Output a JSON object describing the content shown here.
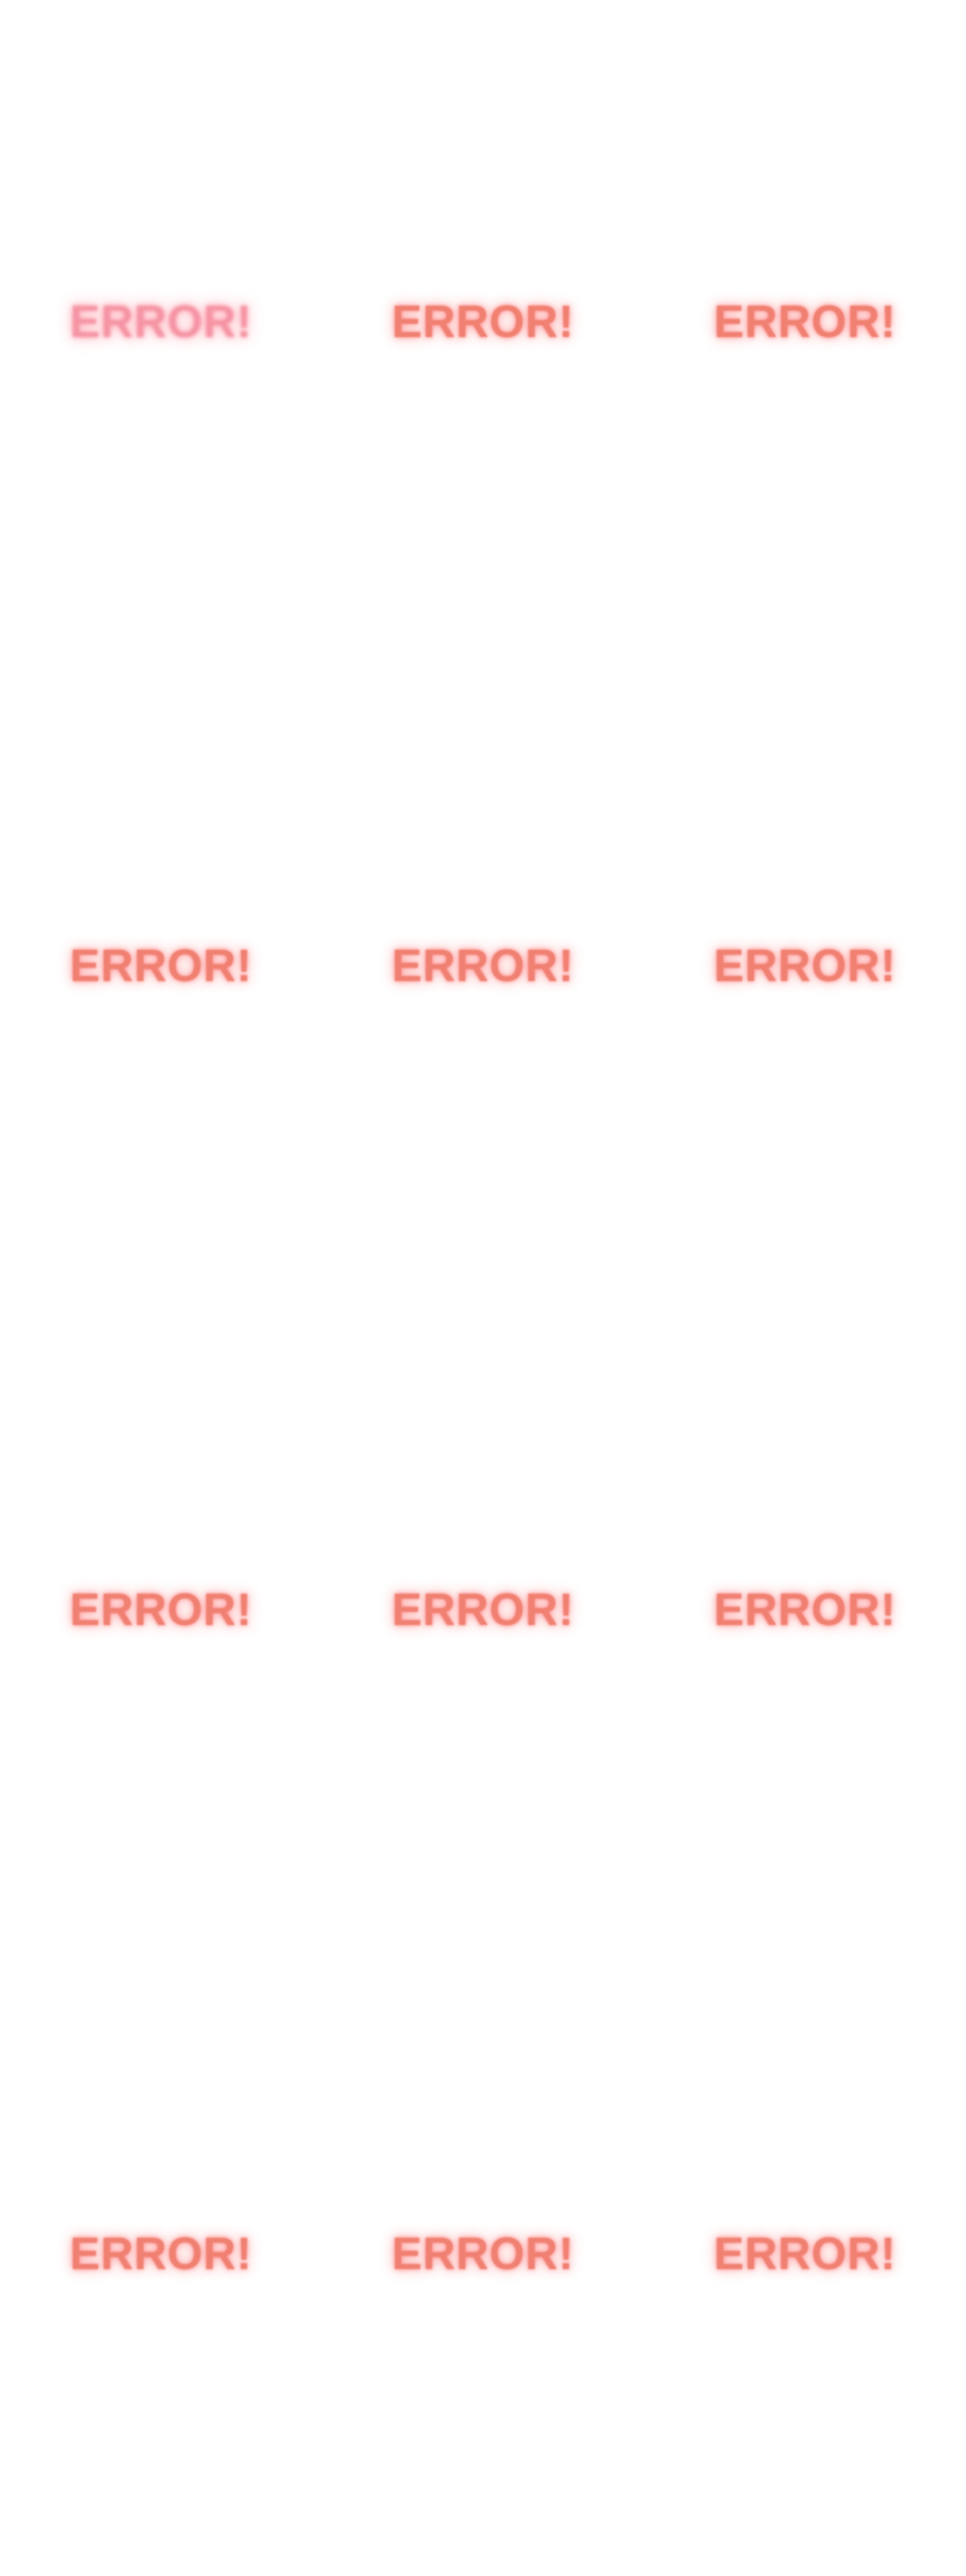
{
  "tiles": [
    {
      "text": "ERROR!"
    },
    {
      "text": "ERROR!"
    },
    {
      "text": "ERROR!"
    },
    {
      "text": "ERROR!"
    },
    {
      "text": "ERROR!"
    },
    {
      "text": "ERROR!"
    },
    {
      "text": "ERROR!"
    },
    {
      "text": "ERROR!"
    },
    {
      "text": "ERROR!"
    },
    {
      "text": "ERROR!"
    },
    {
      "text": "ERROR!"
    },
    {
      "text": "ERROR!"
    }
  ],
  "colors": {
    "background": "#ffffff",
    "text": "#f07a6a",
    "glow": "#ff7070"
  }
}
